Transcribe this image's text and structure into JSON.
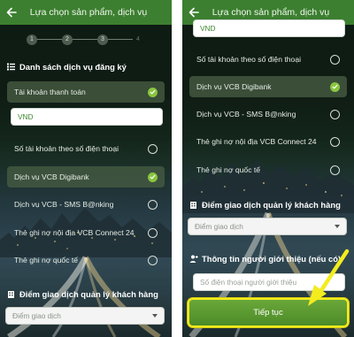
{
  "header": {
    "title": "Lựa chọn sản phẩm, dịch vụ"
  },
  "steps": [
    "1",
    "2",
    "3",
    "4"
  ],
  "left": {
    "section_services": "Danh sách dịch vụ đăng ký",
    "services": [
      {
        "label": "Tài khoản thanh toán",
        "checked": true
      },
      {
        "label": "Số tài khoản theo số điện thoại",
        "checked": false
      },
      {
        "label": "Dịch vụ VCB Digibank",
        "checked": true
      },
      {
        "label": "Dịch vụ VCB - SMS B@nking",
        "checked": false
      },
      {
        "label": "Thẻ ghi nợ nội địa VCB Connect 24",
        "checked": false
      },
      {
        "label": "Thẻ ghi nợ quốc tế",
        "checked": false
      }
    ],
    "currency_value": "VND",
    "section_branch": "Điểm giao dịch quản lý khách hàng",
    "branch_placeholder": "Điểm giao dịch"
  },
  "right": {
    "currency_value": "VND",
    "services": [
      {
        "label": "Số tài khoản theo số điện thoại",
        "checked": false
      },
      {
        "label": "Dịch vụ VCB Digibank",
        "checked": true
      },
      {
        "label": "Dịch vụ VCB - SMS B@nking",
        "checked": false
      },
      {
        "label": "Thẻ ghi nợ nội địa VCB Connect 24",
        "checked": false
      },
      {
        "label": "Thẻ ghi nợ quốc tế",
        "checked": false
      }
    ],
    "section_branch": "Điểm giao dịch quản lý khách hàng",
    "branch_placeholder": "Điểm giao dịch",
    "section_referrer": "Thông tin người giới thiệu (nếu có)",
    "referrer_placeholder": "Số điện thoại người giới thiệu",
    "continue_label": "Tiếp tục"
  },
  "colors": {
    "header_green": "#3c7f30",
    "check_green": "#8ac43f",
    "button_green": "#5a9a30",
    "highlight_yellow": "#f3ec1e"
  }
}
